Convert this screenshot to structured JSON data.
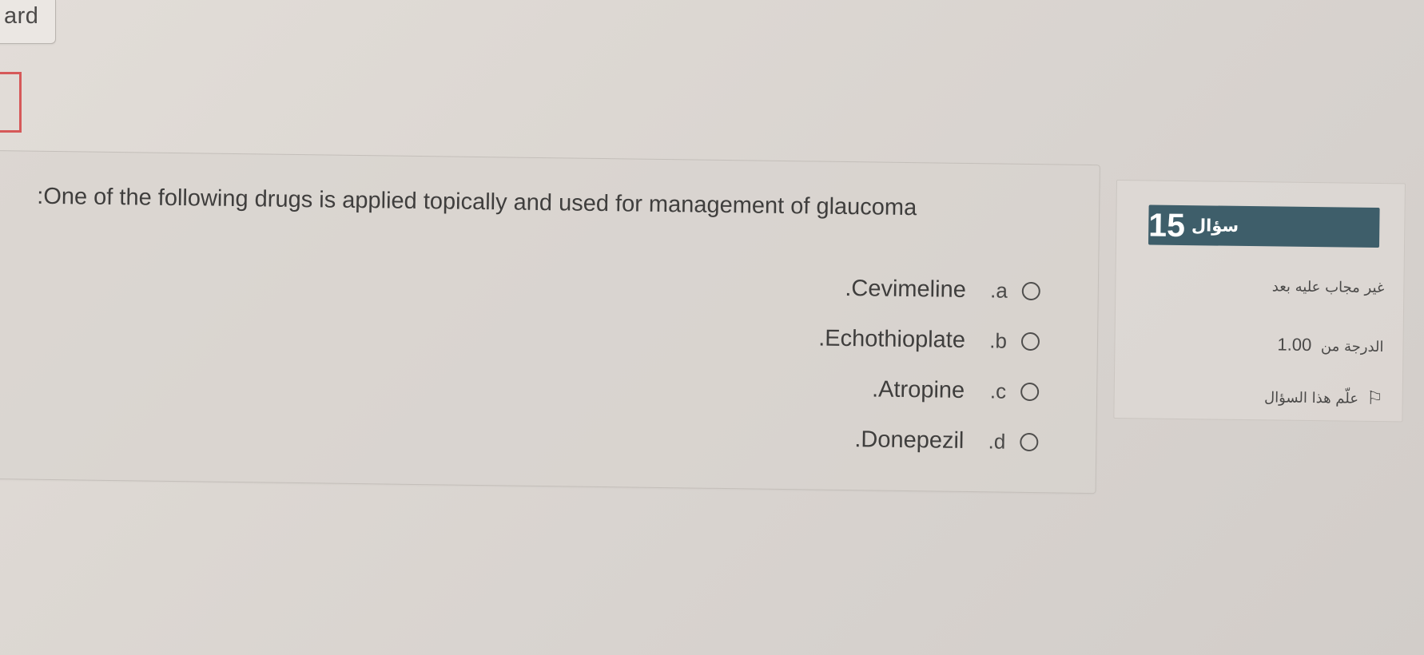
{
  "top_tab": {
    "label": "ard"
  },
  "question": {
    "text": ":One of the following drugs is applied topically and used for management of glaucoma",
    "options": [
      {
        "letter": ".a",
        "text": ".Cevimeline"
      },
      {
        "letter": ".b",
        "text": ".Echothioplate"
      },
      {
        "letter": ".c",
        "text": ".Atropine"
      },
      {
        "letter": ".d",
        "text": ".Donepezil"
      }
    ]
  },
  "info_panel": {
    "question_label": "سؤال",
    "question_number": "15",
    "status": "غير مجاب عليه بعد",
    "grade_label": "الدرجة من",
    "grade_value": "1.00",
    "flag_label": "علّم هذا السؤال",
    "flag_icon": "flag-outline-icon",
    "badge_color": "#3e5e6a"
  }
}
